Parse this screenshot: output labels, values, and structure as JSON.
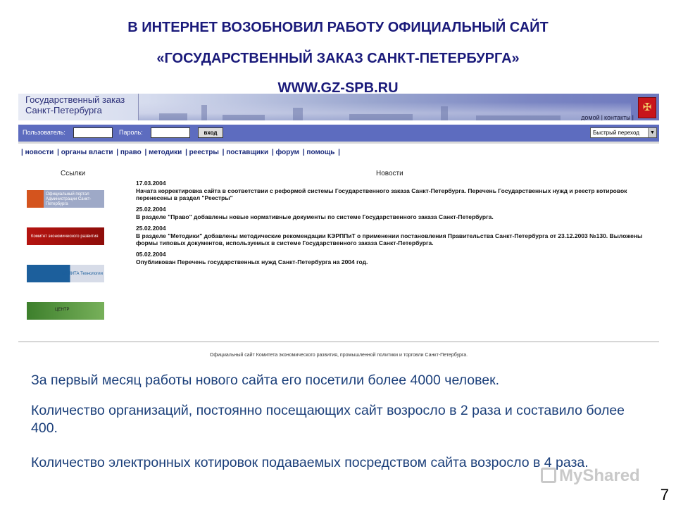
{
  "slide": {
    "title_lines": [
      "В ИНТЕРНЕТ ВОЗОБНОВИЛ РАБОТУ ОФИЦИАЛЬНЫЙ САЙТ",
      "«ГОСУДАРСТВЕННЫЙ ЗАКАЗ САНКТ-ПЕТЕРБУРГА»",
      "WWW.GZ-SPB.RU"
    ],
    "paragraphs": [
      "За первый месяц работы нового сайта его посетили более 4000 человек.",
      "Количество организаций, постоянно посещающих сайт возросло в 2 раза и составило более 400.",
      "Количество электронных котировок подаваемых посредством сайта возросло в 4 раза."
    ],
    "page_number": "7",
    "watermark": "MyShared"
  },
  "site": {
    "logo_line1": "Государственный заказ",
    "logo_line2": "Санкт-Петербурга",
    "top_links": [
      "домой",
      "контакты"
    ],
    "user_label": "Пользователь:",
    "password_label": "Пароль:",
    "login_button": "вход",
    "quick_nav": "Быстрый переход",
    "menu": [
      "новости",
      "органы власти",
      "право",
      "методики",
      "реестры",
      "поставщики",
      "форум",
      "помощь"
    ],
    "links_title": "Ссылки",
    "news_title": "Новости",
    "banners": [
      {
        "text": "Официальный портал Администрации Санкт-Петербурга",
        "icon": "city-emblem-icon"
      },
      {
        "text": "Комитет экономического развития",
        "icon": "city-emblem-icon"
      },
      {
        "text": "КОМИТА Технологии",
        "icon": "komita-logo-icon"
      },
      {
        "text": "ЦЕНТР",
        "icon": "center-logo-icon"
      }
    ],
    "news": [
      {
        "date": "17.03.2004",
        "text": "Начата корректировка сайта в соответствии с реформой системы Государственного заказа Санкт-Петербурга. Перечень Государственных нужд и реестр котировок перенесены в раздел \"Реестры\""
      },
      {
        "date": "25.02.2004",
        "text": "В разделе \"Право\" добавлены новые нормативные документы по системе Государственного заказа Санкт-Петербурга."
      },
      {
        "date": "25.02.2004",
        "text": "В разделе \"Методики\" добавлены методические рекомендации КЭРППиТ о применении постановления Правительства Санкт-Петербурга от 23.12.2003 №130. Выложены формы типовых документов, используемых в системе Государственного заказа Санкт-Петербурга."
      },
      {
        "date": "05.02.2004",
        "text": "Опубликован Перечень государственных нужд Санкт-Петербурга на 2004 год."
      }
    ],
    "footer": "Официальный сайт Комитета экономического развития, промышленной политики и торговли Санкт-Петербурга."
  },
  "colors": {
    "title": "#1a1a7a",
    "paragraph": "#1b3f7a",
    "login_bar": "#5d6cbf",
    "menu": "#1a2a7a"
  }
}
